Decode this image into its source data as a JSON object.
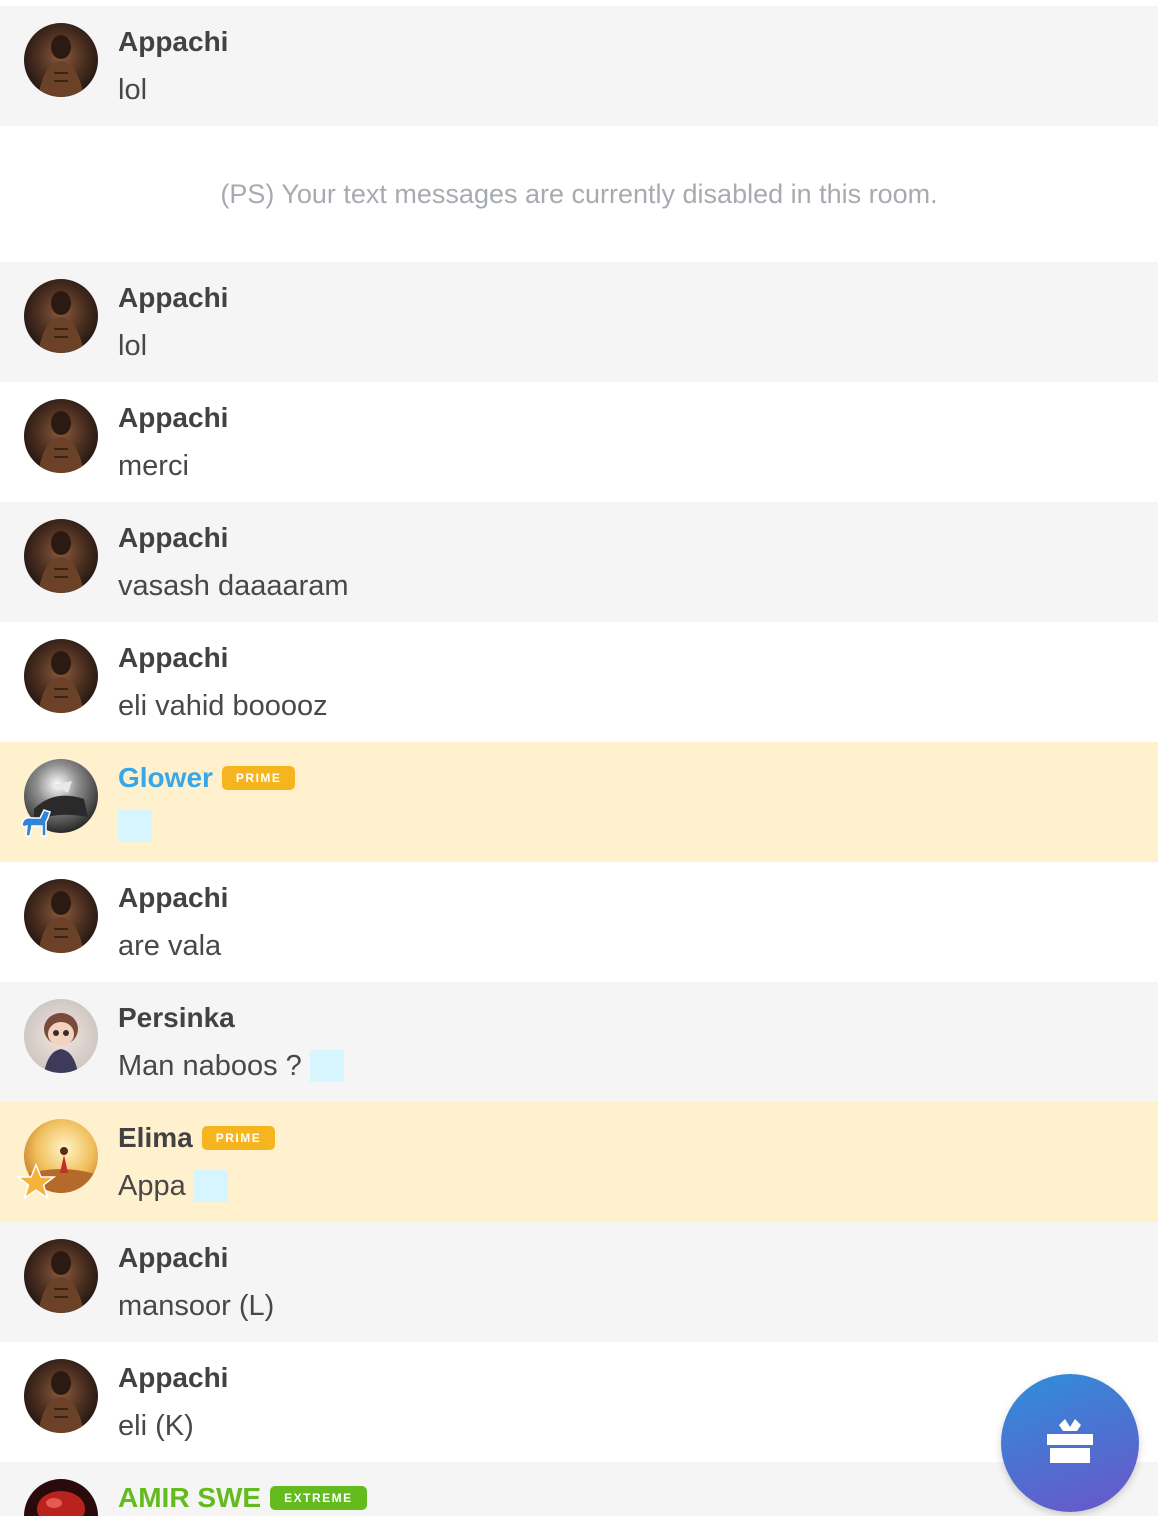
{
  "system_notice": "(PS) Your text messages are currently disabled in this room.",
  "messages": [
    {
      "name": "Appachi",
      "text": "lol"
    },
    {
      "name": "Appachi",
      "text": "lol"
    },
    {
      "name": "Appachi",
      "text": "merci"
    },
    {
      "name": "Appachi",
      "text": "vasash daaaaram"
    },
    {
      "name": "Appachi",
      "text": "eli vahid booooz"
    },
    {
      "name": "Glower",
      "tag": "PRIME",
      "text": ""
    },
    {
      "name": "Appachi",
      "text": "are vala"
    },
    {
      "name": "Persinka",
      "text": "Man naboos ?"
    },
    {
      "name": "Elima",
      "tag": "PRIME",
      "text": "Appa"
    },
    {
      "name": "Appachi",
      "text": "mansoor (L)"
    },
    {
      "name": "Appachi",
      "text": "eli (K)"
    },
    {
      "name": "AMIR SWE",
      "tag": "EXTREME",
      "text": ""
    }
  ],
  "icons": {
    "gift_button": "gift-icon",
    "glower_badge": "horse-icon",
    "elima_badge": "star-icon",
    "emoji_placeholder": "emoji-icon"
  },
  "colors": {
    "prime_tag": "#f6b51f",
    "extreme_tag": "#63bb1e",
    "glower_name": "#35a7ea",
    "amir_name": "#63bb1e",
    "prime_row_bg": "#fff0ce",
    "gift_button_gradient": [
      "#2f8fd9",
      "#6c55c8"
    ]
  }
}
